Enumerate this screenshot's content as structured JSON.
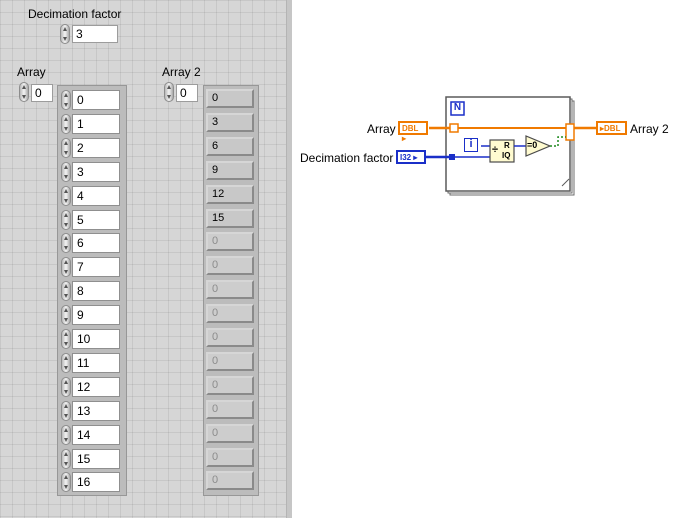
{
  "front_panel": {
    "decimation_label": "Decimation factor",
    "decimation_value": "3",
    "array_label": "Array",
    "array_index": "0",
    "array_values": [
      "0",
      "1",
      "2",
      "3",
      "4",
      "5",
      "6",
      "7",
      "8",
      "9",
      "10",
      "11",
      "12",
      "13",
      "14",
      "15",
      "16"
    ],
    "array2_label": "Array 2",
    "array2_index": "0",
    "array2_values": [
      "0",
      "3",
      "6",
      "9",
      "12",
      "15",
      "0",
      "0",
      "0",
      "0",
      "0",
      "0",
      "0",
      "0",
      "0",
      "0",
      "0"
    ],
    "array2_filled_count": 6
  },
  "block_diagram": {
    "array_label": "Array",
    "array_terminal": "DBL",
    "decimation_label": "Decimation factor",
    "decimation_terminal": "I32",
    "array2_label": "Array 2",
    "array2_terminal": "DBL",
    "for_loop_count": "N",
    "for_loop_index": "i",
    "quotient_remainder_r": "R",
    "quotient_remainder_iq": "IQ",
    "equal_zero": "=0"
  },
  "colors": {
    "dbl_wire": "#f07a00",
    "i32_wire": "#1a2fc8"
  }
}
